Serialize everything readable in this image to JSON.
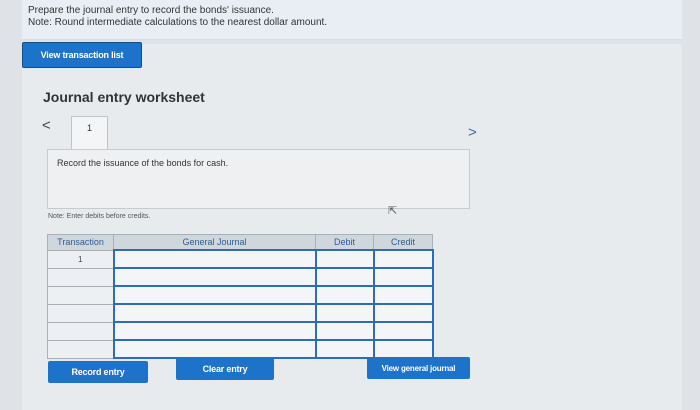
{
  "instructions": {
    "line1": "Prepare the journal entry to record the bonds' issuance.",
    "line2": "Note: Round intermediate calculations to the nearest dollar amount."
  },
  "buttons": {
    "view_transaction_list": "View transaction list",
    "record_entry": "Record entry",
    "clear_entry": "Clear entry",
    "view_general_journal": "View general journal"
  },
  "worksheet": {
    "title": "Journal entry worksheet",
    "prev": "<",
    "next": ">",
    "tab_number": "1",
    "prompt": "Record the issuance of the bonds for cash.",
    "note": "Note: Enter debits before credits."
  },
  "table": {
    "headers": [
      "Transaction",
      "General Journal",
      "Debit",
      "Credit"
    ],
    "rows": [
      {
        "transaction": "1"
      },
      {
        "transaction": ""
      },
      {
        "transaction": ""
      },
      {
        "transaction": ""
      },
      {
        "transaction": ""
      },
      {
        "transaction": ""
      }
    ]
  },
  "icons": {
    "cursor": "mouse-pointer-icon"
  }
}
